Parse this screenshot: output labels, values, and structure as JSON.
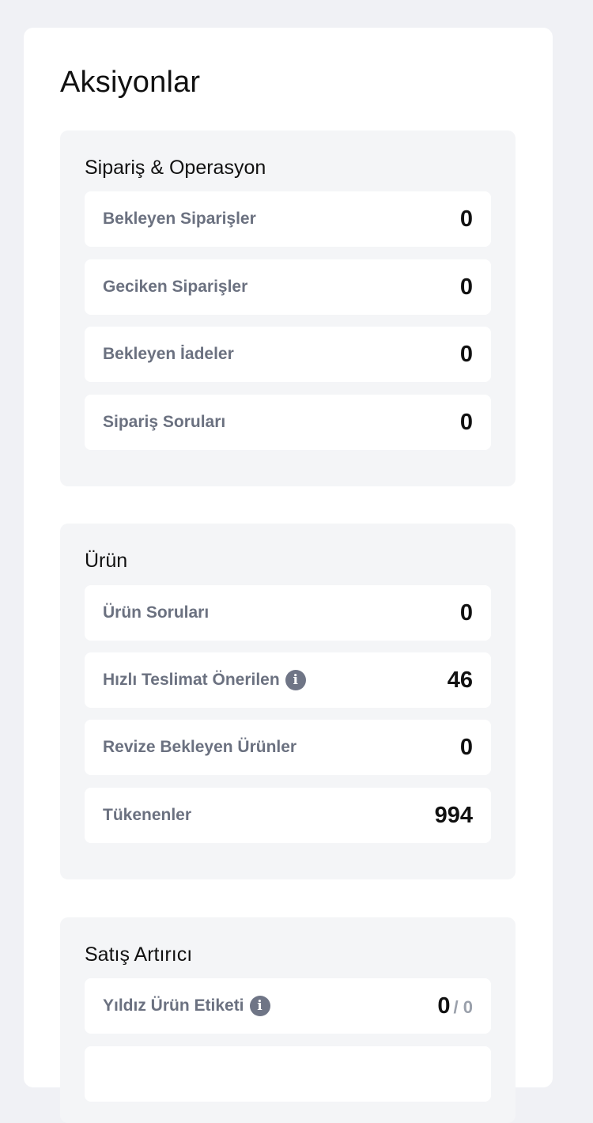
{
  "page": {
    "title": "Aksiyonlar"
  },
  "sections": [
    {
      "title": "Sipariş & Operasyon",
      "rows": [
        {
          "label": "Bekleyen Siparişler",
          "value": "0"
        },
        {
          "label": "Geciken Siparişler",
          "value": "0"
        },
        {
          "label": "Bekleyen İadeler",
          "value": "0"
        },
        {
          "label": "Sipariş Soruları",
          "value": "0"
        }
      ]
    },
    {
      "title": "Ürün",
      "rows": [
        {
          "label": "Ürün Soruları",
          "value": "0"
        },
        {
          "label": "Hızlı Teslimat Önerilen",
          "value": "46",
          "icon": "info-icon"
        },
        {
          "label": "Revize Bekleyen Ürünler",
          "value": "0"
        },
        {
          "label": "Tükenenler",
          "value": "994"
        }
      ]
    },
    {
      "title": "Satış Artırıcı",
      "rows": [
        {
          "label": "Yıldız Ürün Etiketi",
          "value": "0",
          "total": "/ 0",
          "icon": "info-icon"
        },
        {
          "label": "",
          "value": ""
        }
      ]
    }
  ],
  "icons": {
    "info": "i"
  },
  "colors": {
    "background": "#f0f1f5",
    "card": "#ffffff",
    "section": "#f4f5f7",
    "label": "#6b7180",
    "value": "#111111",
    "icon": "#6f7586"
  }
}
